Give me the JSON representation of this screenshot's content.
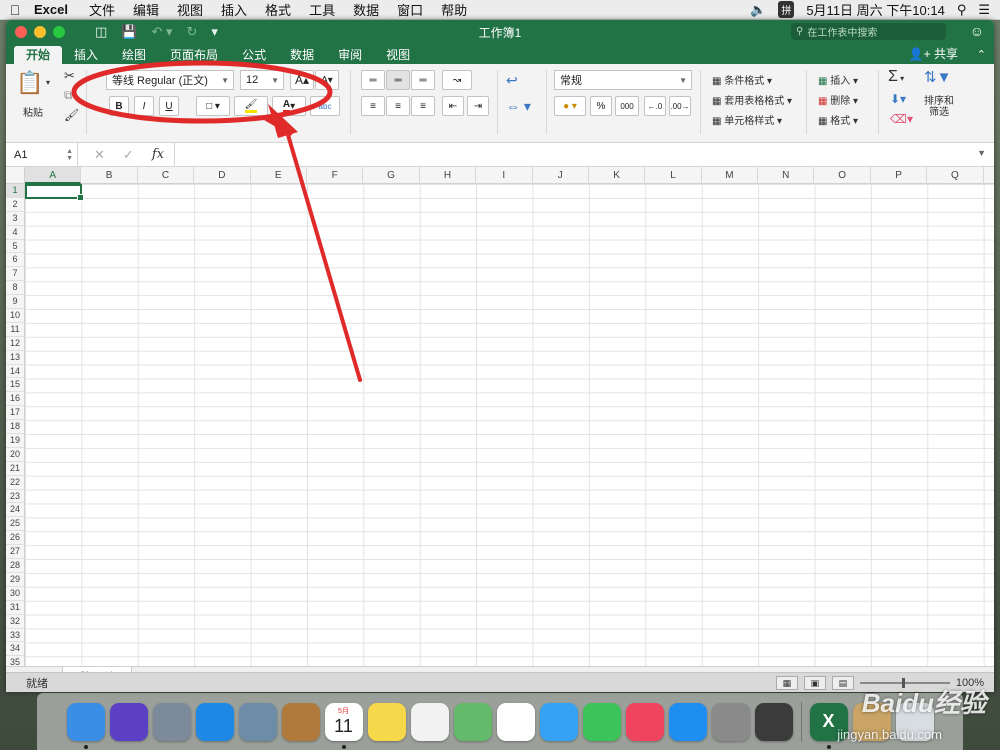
{
  "menubar": {
    "app_name": "Excel",
    "items": [
      "文件",
      "编辑",
      "视图",
      "插入",
      "格式",
      "工具",
      "数据",
      "窗口",
      "帮助"
    ],
    "ime": "拼",
    "datetime": "5月11日 周六 下午10:14"
  },
  "window": {
    "title": "工作簿1",
    "search_placeholder": "在工作表中搜索",
    "share_label": "共享"
  },
  "ribbon": {
    "tabs": [
      "开始",
      "插入",
      "绘图",
      "页面布局",
      "公式",
      "数据",
      "审阅",
      "视图"
    ],
    "active_tab": "开始",
    "paste_label": "粘贴",
    "font_name": "等线 Regular (正文)",
    "font_size": "12",
    "bold": "B",
    "italic": "I",
    "underline": "U",
    "number_format": "常规",
    "percent": "%",
    "thousands": "000",
    "conditional_format": "条件格式",
    "table_format": "套用表格格式",
    "cell_style": "单元格样式",
    "insert": "插入",
    "delete": "删除",
    "format": "格式",
    "sort_filter_line1": "排序和",
    "sort_filter_line2": "筛选",
    "sum_symbol": "Σ",
    "wrap_label": "abc"
  },
  "formula_bar": {
    "name_box": "A1",
    "cancel": "✕",
    "confirm": "✓",
    "fx": "fx",
    "value": ""
  },
  "grid": {
    "columns": [
      "A",
      "B",
      "C",
      "D",
      "E",
      "F",
      "G",
      "H",
      "I",
      "J",
      "K",
      "L",
      "M",
      "N",
      "O",
      "P",
      "Q"
    ],
    "rows": [
      "1",
      "2",
      "3",
      "4",
      "5",
      "6",
      "7",
      "8",
      "9",
      "10",
      "11",
      "12",
      "13",
      "14",
      "15",
      "16",
      "17",
      "18",
      "19",
      "20",
      "21",
      "22",
      "23",
      "24",
      "25",
      "26",
      "27",
      "28",
      "29",
      "30",
      "31",
      "32",
      "33",
      "34",
      "35"
    ],
    "selected_cell": "A1"
  },
  "sheets": {
    "tabs": [
      "Sheet1"
    ],
    "add": "+"
  },
  "status": {
    "ready": "就绪",
    "zoom": "100%"
  },
  "dock": {
    "calendar_month": "5月",
    "calendar_day": "11",
    "apps": [
      {
        "name": "finder",
        "color": "#3a8ee6"
      },
      {
        "name": "siri",
        "color": "#5b3fc4"
      },
      {
        "name": "launchpad",
        "color": "#7d8a99"
      },
      {
        "name": "safari",
        "color": "#1e88e5"
      },
      {
        "name": "preview",
        "color": "#6c8ca8"
      },
      {
        "name": "contacts",
        "color": "#b07a3c"
      },
      {
        "name": "calendar",
        "color": "#ffffff"
      },
      {
        "name": "notes",
        "color": "#f6d84a"
      },
      {
        "name": "reminders",
        "color": "#f2f2f2"
      },
      {
        "name": "maps",
        "color": "#65b96a"
      },
      {
        "name": "photos",
        "color": "#ffffff"
      },
      {
        "name": "messages",
        "color": "#35a2f4"
      },
      {
        "name": "facetime",
        "color": "#3cc35a"
      },
      {
        "name": "music",
        "color": "#f0435d"
      },
      {
        "name": "app-store",
        "color": "#1f8ef1"
      },
      {
        "name": "system-preferences",
        "color": "#8a8a8a"
      },
      {
        "name": "quicktime",
        "color": "#3b3b3b"
      },
      {
        "name": "excel",
        "color": "#217346"
      }
    ]
  },
  "watermark": {
    "brand": "Baidu经验",
    "url": "jingyan.baidu.com"
  },
  "colors": {
    "excel_green": "#217346",
    "annotation_red": "#e02a2a"
  }
}
